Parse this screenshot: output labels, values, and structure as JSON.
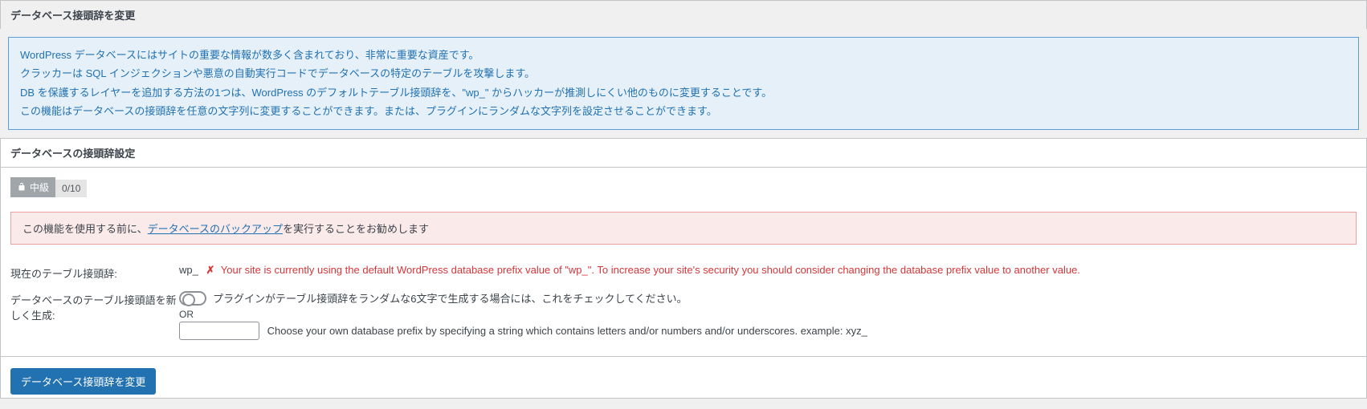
{
  "header": {
    "title": "データベース接頭辞を変更"
  },
  "info": {
    "line1": "WordPress データベースにはサイトの重要な情報が数多く含まれており、非常に重要な資産です。",
    "line2": "クラッカーは SQL インジェクションや悪意の自動実行コードでデータベースの特定のテーブルを攻撃します。",
    "line3": "DB を保護するレイヤーを追加する方法の1つは、WordPress のデフォルトテーブル接頭辞を、\"wp_\" からハッカーが推測しにくい他のものに変更することです。",
    "line4": "この機能はデータベースの接頭辞を任意の文字列に変更することができます。または、プラグインにランダムな文字列を設定させることができます。"
  },
  "section": {
    "title": "データベースの接頭辞設定"
  },
  "badge": {
    "level": "中級",
    "score": "0/10"
  },
  "warning": {
    "before": "この機能を使用する前に、",
    "link": "データベースのバックアップ",
    "after": "を実行することをお勧めします"
  },
  "current": {
    "label": "現在のテーブル接頭辞:",
    "value": "wp_",
    "warn_text": "Your site is currently using the default WordPress database prefix value of \"wp_\". To increase your site's security you should consider changing the database prefix value to another value."
  },
  "generate": {
    "label": "データベースのテーブル接頭語を新しく生成:",
    "toggle_help": "プラグインがテーブル接頭辞をランダムな6文字で生成する場合には、これをチェックしてください。",
    "or": "OR",
    "input_value": "",
    "input_help": "Choose your own database prefix by specifying a string which contains letters and/or numbers and/or underscores. example: xyz_"
  },
  "submit": {
    "label": "データベース接頭辞を変更"
  }
}
